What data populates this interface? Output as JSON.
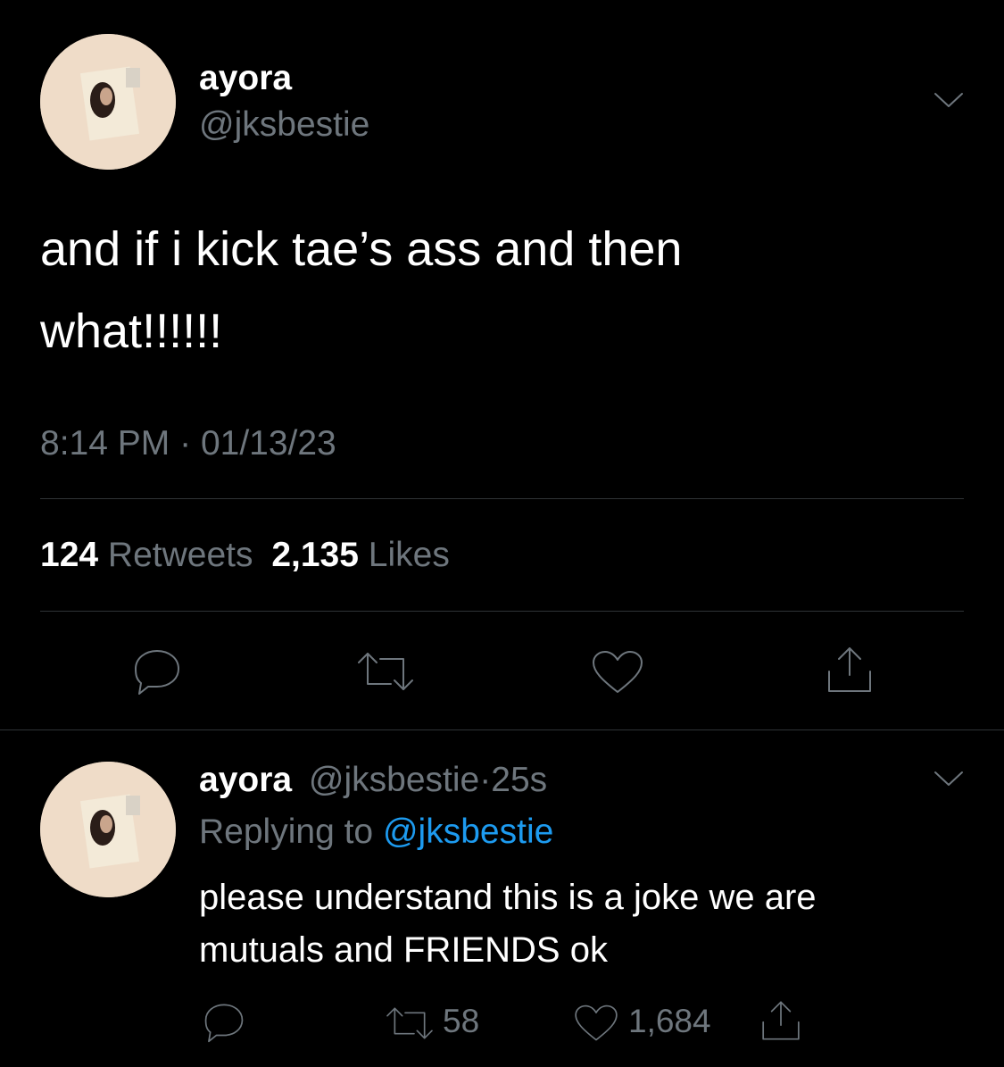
{
  "main_tweet": {
    "display_name": "ayora",
    "handle": "@jksbestie",
    "text_line1": "and if i kick tae’s ass and then",
    "text_line2": "what!!!!!!",
    "time": "8:14 PM",
    "separator": "·",
    "date": "01/13/23",
    "retweet_count": "124",
    "retweet_label": "Retweets",
    "like_count": "2,135",
    "like_label": "Likes",
    "icons": [
      "reply-icon",
      "retweet-icon",
      "like-icon",
      "share-icon"
    ]
  },
  "reply_tweet": {
    "display_name": "ayora",
    "handle": "@jksbestie",
    "separator": "·",
    "age": "25s",
    "replying_label": "Replying to",
    "replying_handle": "@jksbestie",
    "text_line1": "please understand this is a joke we are",
    "text_line2": "mutuals and FRIENDS ok",
    "retweet_count": "58",
    "like_count": "1,684",
    "icons": [
      "reply-icon",
      "retweet-icon",
      "like-icon",
      "share-icon"
    ]
  },
  "colors": {
    "background": "#000000",
    "text": "#ffffff",
    "muted": "#6e767d",
    "link": "#1d9bf0",
    "divider": "#2f3336"
  }
}
